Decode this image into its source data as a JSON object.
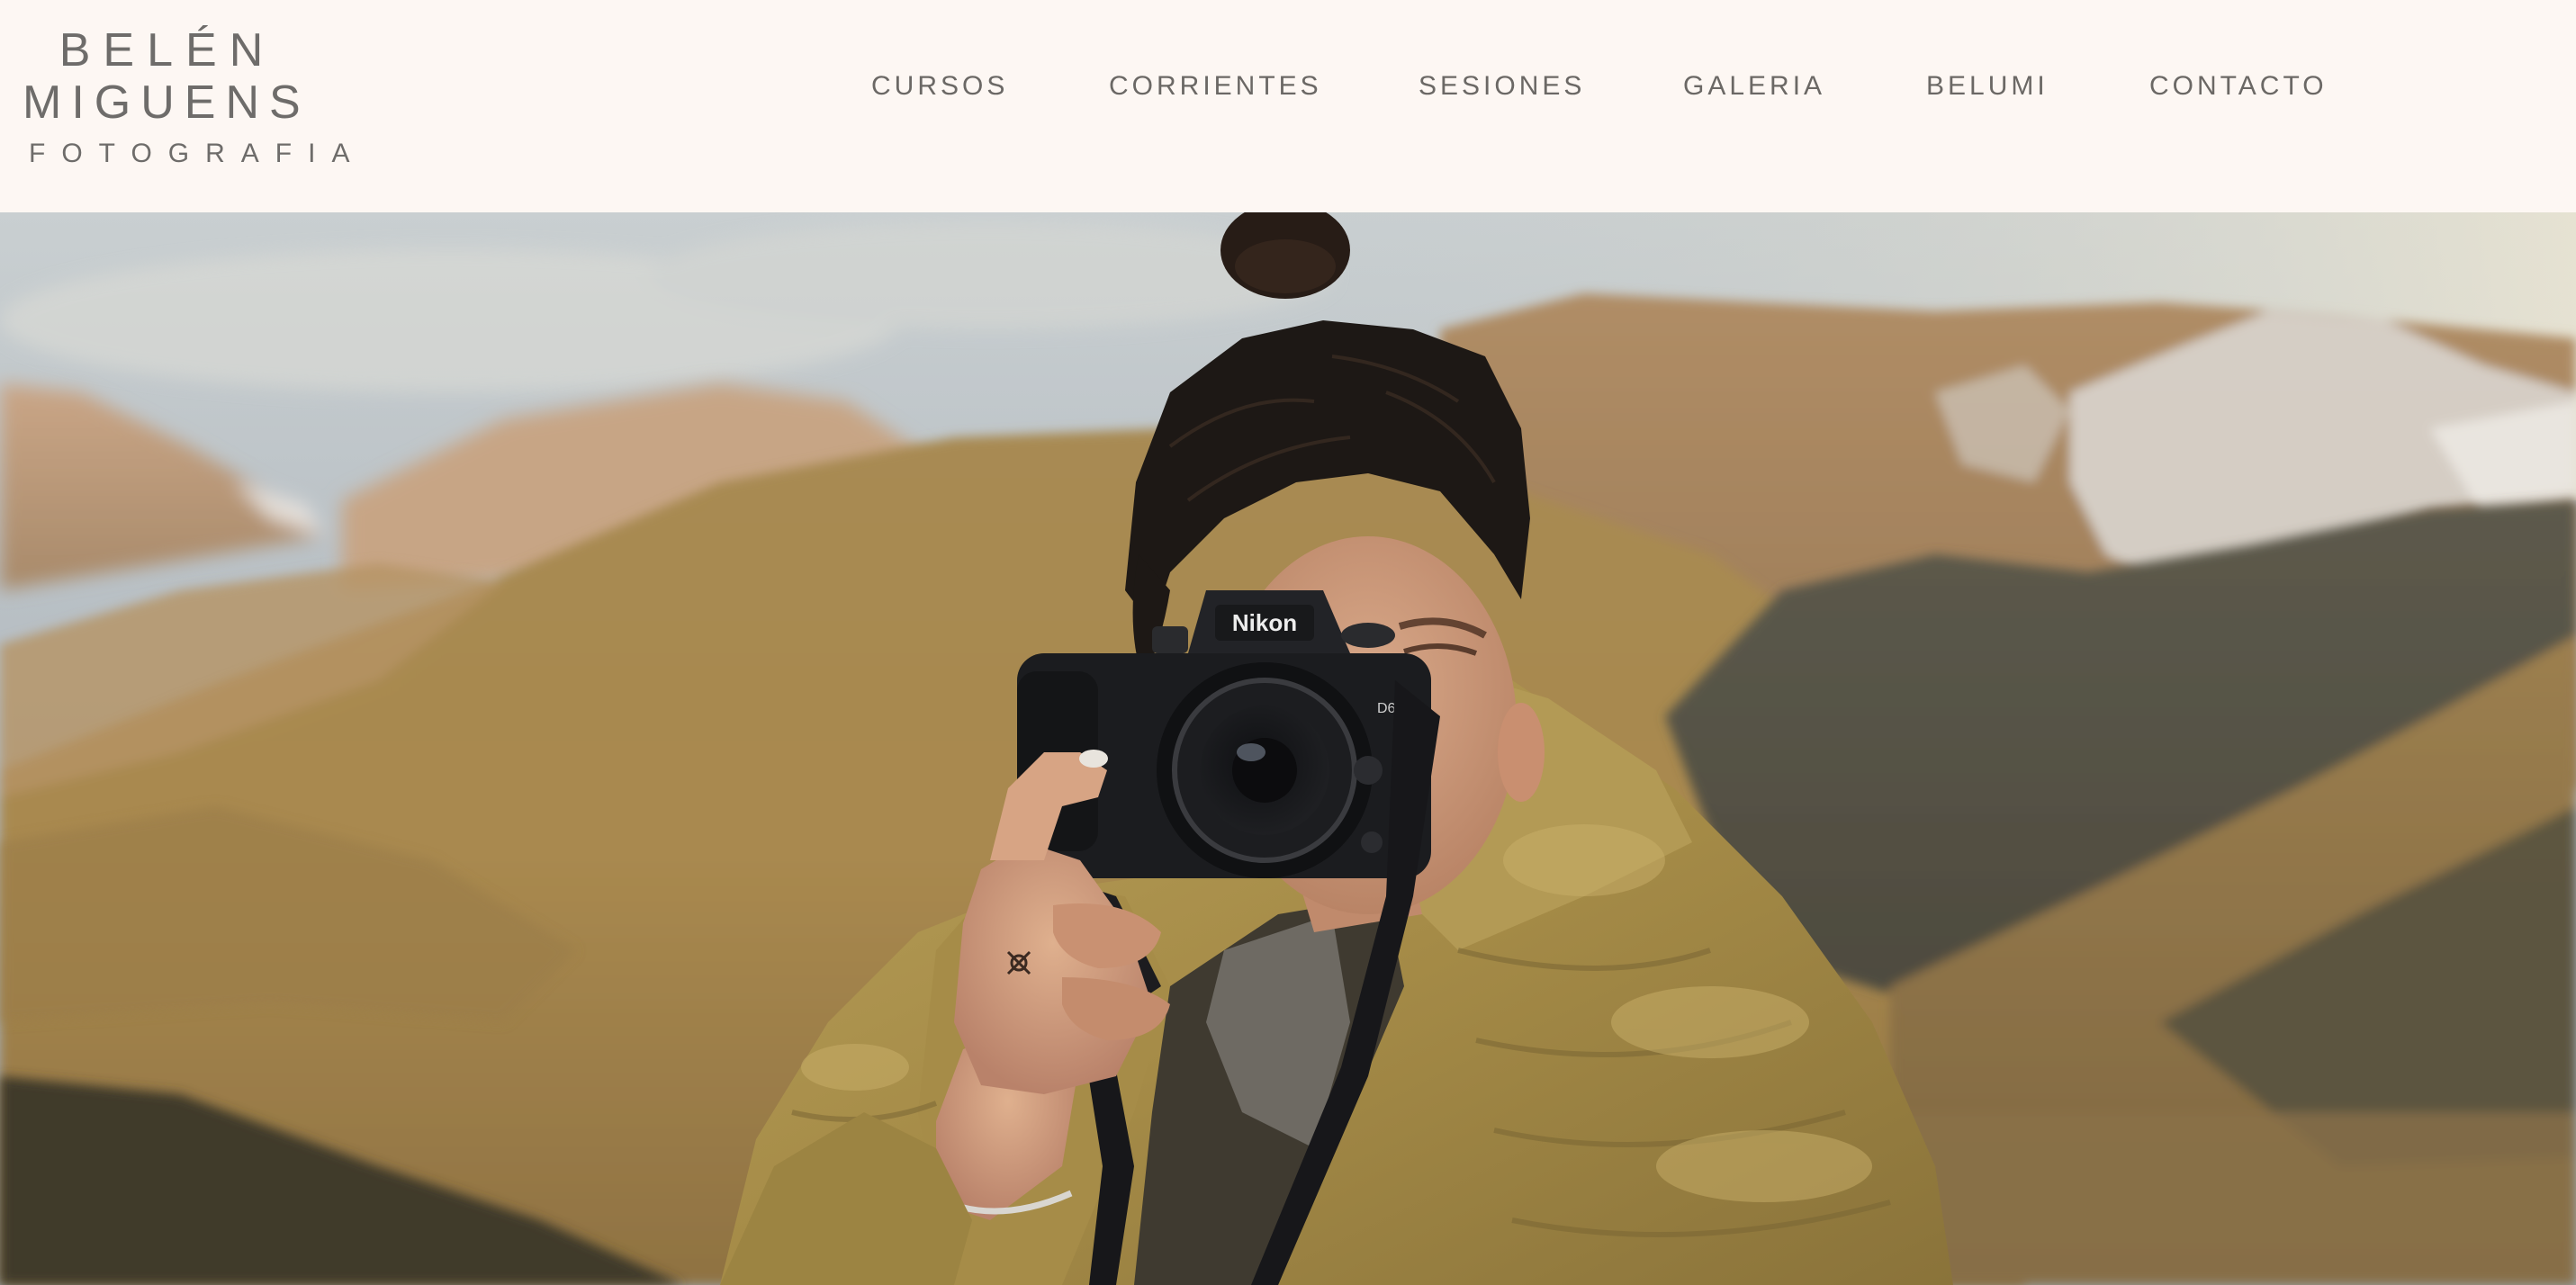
{
  "brand": {
    "line1": "BELÉN",
    "line2": "MIGUENS",
    "subtitle": "FOTOGRAFIA"
  },
  "nav": {
    "items": [
      {
        "label": "CURSOS"
      },
      {
        "label": "CORRIENTES"
      },
      {
        "label": "SESIONES"
      },
      {
        "label": "GALERIA"
      },
      {
        "label": "BELUMI"
      },
      {
        "label": "CONTACTO"
      }
    ]
  },
  "hero": {
    "camera_brand": "Nikon",
    "camera_model": "D600"
  },
  "colors": {
    "header_background": "#fdf7f3",
    "text_gray": "#6b6865",
    "jacket_olive": "#a38a45",
    "mountain_ochre": "#b08a55"
  }
}
